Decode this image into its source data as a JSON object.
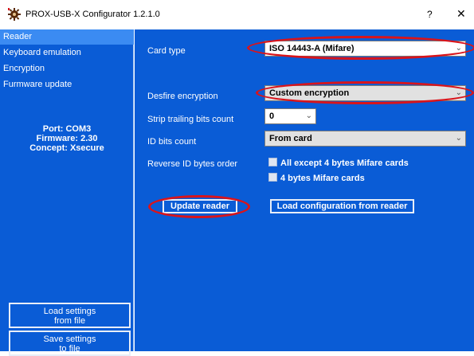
{
  "window": {
    "title": "PROX-USB-X Configurator 1.2.1.0",
    "help": "?",
    "close": "✕"
  },
  "sidebar": {
    "items": [
      {
        "label": "Reader",
        "active": true
      },
      {
        "label": "Keyboard emulation"
      },
      {
        "label": "Encryption"
      },
      {
        "label": "Furmware update"
      }
    ],
    "info": {
      "port": "Port: COM3",
      "firmware": "Firmware: 2.30",
      "concept": "Concept: Xsecure"
    },
    "load_button": {
      "line1": "Load settings",
      "line2": "from file"
    },
    "save_button": {
      "line1": "Save settings",
      "line2": "to file"
    }
  },
  "form": {
    "card_type": {
      "label": "Card type",
      "value": "ISO 14443-A (Mifare)"
    },
    "desfire_encryption": {
      "label": "Desfire encryption",
      "value": "Custom encryption"
    },
    "strip_trailing": {
      "label": "Strip trailing bits count",
      "value": "0"
    },
    "id_bits": {
      "label": "ID bits count",
      "value": "From card"
    },
    "reverse_id": {
      "label": "Reverse ID bytes order",
      "options": [
        {
          "label": "All except 4 bytes Mifare cards",
          "checked": false
        },
        {
          "label": "4 bytes Mifare cards",
          "checked": false
        }
      ]
    }
  },
  "buttons": {
    "update_reader": "Update reader",
    "load_config": "Load configuration from reader"
  },
  "colors": {
    "background": "#0a5cd6",
    "highlight": "#d9141b",
    "active_item": "#3b8bf2"
  },
  "icons": {
    "app": "gear-icon",
    "chevron": "chevron-down-icon"
  }
}
